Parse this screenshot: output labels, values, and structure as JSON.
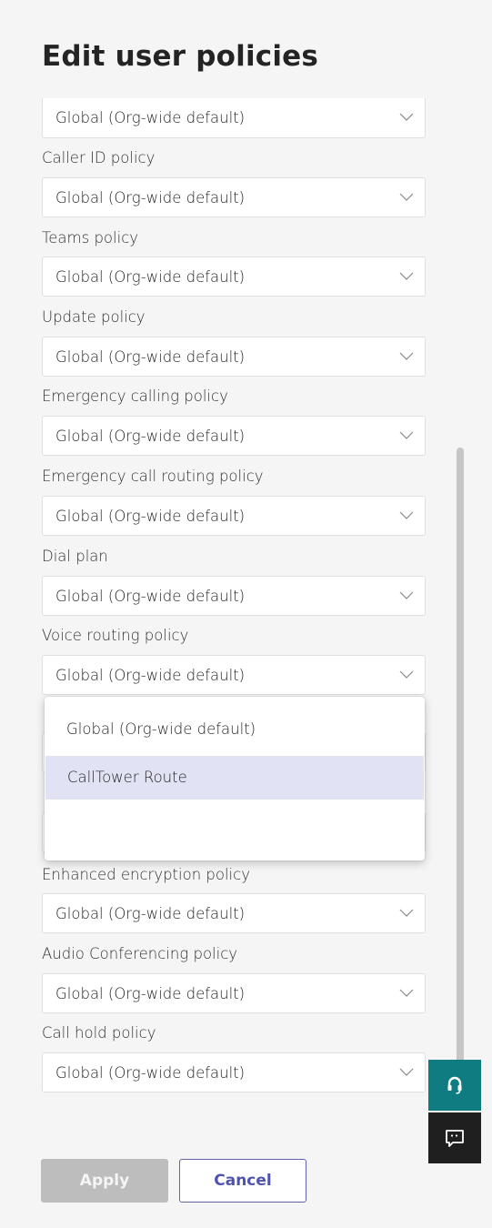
{
  "page": {
    "title": "Edit user policies"
  },
  "fields": [
    {
      "label": "",
      "value": "Global (Org-wide default)"
    },
    {
      "label": "Caller ID policy",
      "value": "Global (Org-wide default)"
    },
    {
      "label": "Teams policy",
      "value": "Global (Org-wide default)"
    },
    {
      "label": "Update policy",
      "value": "Global (Org-wide default)"
    },
    {
      "label": "Emergency calling policy",
      "value": "Global (Org-wide default)"
    },
    {
      "label": "Emergency call routing policy",
      "value": "Global (Org-wide default)"
    },
    {
      "label": "Dial plan",
      "value": "Global (Org-wide default)"
    },
    {
      "label": "Voice routing policy",
      "value": "Global (Org-wide default)"
    },
    {
      "label": "Enhanced encryption policy",
      "value": "Global (Org-wide default)"
    },
    {
      "label": "Audio Conferencing policy",
      "value": "Global (Org-wide default)"
    },
    {
      "label": "Call hold policy",
      "value": "Global (Org-wide default)"
    }
  ],
  "dropdown": {
    "options": [
      "Global (Org-wide default)",
      "CallTower Route",
      ""
    ],
    "highlighted": "CallTower Route"
  },
  "actions": {
    "apply_label": "Apply",
    "cancel_label": "Cancel"
  },
  "side_buttons": [
    {
      "icon": "support-headset-icon"
    },
    {
      "icon": "feedback-chat-icon"
    }
  ],
  "colors": {
    "accent": "#6264a7",
    "support": "#0e7c80",
    "highlight": "#e1e2f4"
  }
}
